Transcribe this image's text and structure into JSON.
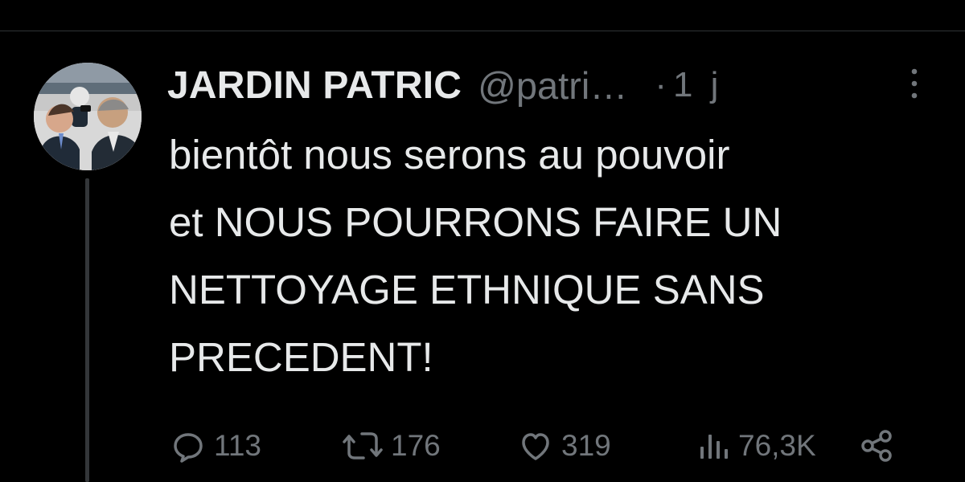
{
  "tweet": {
    "author": {
      "display_name": "JARDIN PATRIC",
      "handle": "@patri…"
    },
    "separator": "·",
    "time": "1 j",
    "text_lines": [
      "bientôt nous serons au pouvoir",
      "et NOUS POURRONS FAIRE UN",
      "NETTOYAGE ETHNIQUE SANS",
      "PRECEDENT!"
    ],
    "actions": {
      "reply": {
        "icon": "reply-icon",
        "count": "113"
      },
      "retweet": {
        "icon": "retweet-icon",
        "count": "176"
      },
      "like": {
        "icon": "heart-icon",
        "count": "319"
      },
      "views": {
        "icon": "views-icon",
        "count": "76,3K"
      },
      "share": {
        "icon": "share-icon"
      }
    },
    "menu": {
      "icon": "more-vertical-icon"
    }
  },
  "colors": {
    "background": "#000000",
    "text": "#e7e9ea",
    "muted": "#71767b",
    "divider": "#2f3336"
  }
}
